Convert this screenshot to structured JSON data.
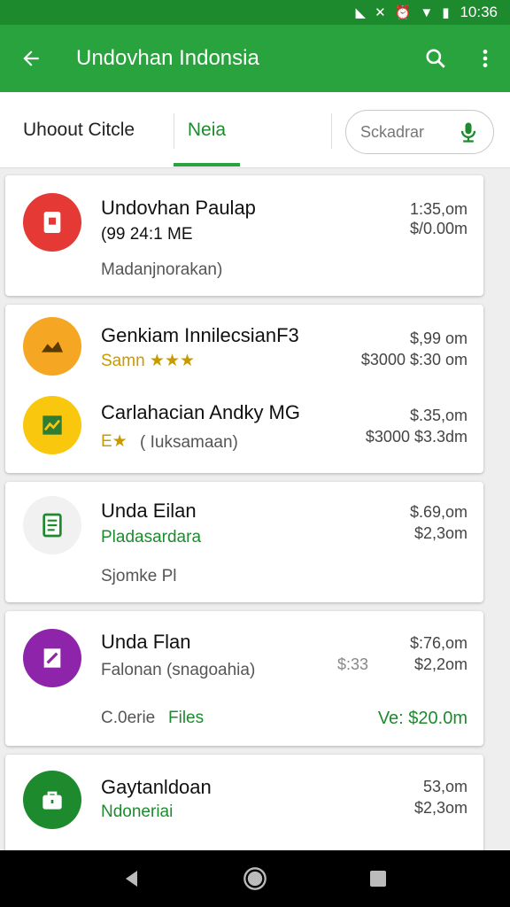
{
  "status_bar": {
    "time": "10:36",
    "icons": [
      "nfc-icon",
      "no-sim-icon",
      "alarm-icon",
      "wifi-icon",
      "battery-icon"
    ]
  },
  "app_bar": {
    "title": "Undovhan Indonsia",
    "actions": [
      "back-arrow-icon",
      "search-icon",
      "more-vert-icon"
    ]
  },
  "tabs": [
    {
      "label": "Uhoout Citcle",
      "selected": false
    },
    {
      "label": "Neia",
      "selected": true
    }
  ],
  "search": {
    "placeholder": "Sckadrar"
  },
  "items": [
    {
      "name": "Undovhan Paulap",
      "sub": "(99 24:1 ME",
      "note": "Madanjnorakan)",
      "right1": "1:35,om",
      "right2": "$/0.00m",
      "icon": "document-icon",
      "color": "#e53935"
    },
    {
      "name": "Genkiam InnilecsianF3",
      "sub": "Samn ★★★",
      "right1": "$,99 om",
      "right2": "$3000 $:30 om",
      "icon": "map-pin-icon",
      "color": "#f5a623"
    },
    {
      "name": "Carlahacian Andky MG",
      "sub": "E★",
      "sub2": "( Iuksamaan)",
      "right1": "$.35,om",
      "right2": "$3000 $3.3dm",
      "icon": "chart-icon",
      "color": "#f9c80e"
    },
    {
      "name": "Unda Eilan",
      "sub": "Pladasardara",
      "note": "Sjomke Pl",
      "right1": "$.69,om",
      "right2": "$2,3om",
      "icon": "list-icon",
      "color": "#f1f1f1"
    },
    {
      "name": "Unda Flan",
      "sub": "Falonan (snagoahia)",
      "note": "C.0erie",
      "note_link": "Files",
      "right1": "$:76,om",
      "right2": "$2,2om",
      "right2_prefix": "$:33",
      "footer_right": "Ve: $20.0m",
      "icon": "edit-icon",
      "color": "#8e24aa"
    },
    {
      "name": "Gaytanldoan",
      "sub": "Ndoneriai",
      "right1": "53,om",
      "right2": "$2,3om",
      "icon": "briefcase-icon",
      "color": "#1e8a2e"
    }
  ],
  "nav": [
    "back-nav-icon",
    "home-nav-icon",
    "recents-nav-icon"
  ]
}
